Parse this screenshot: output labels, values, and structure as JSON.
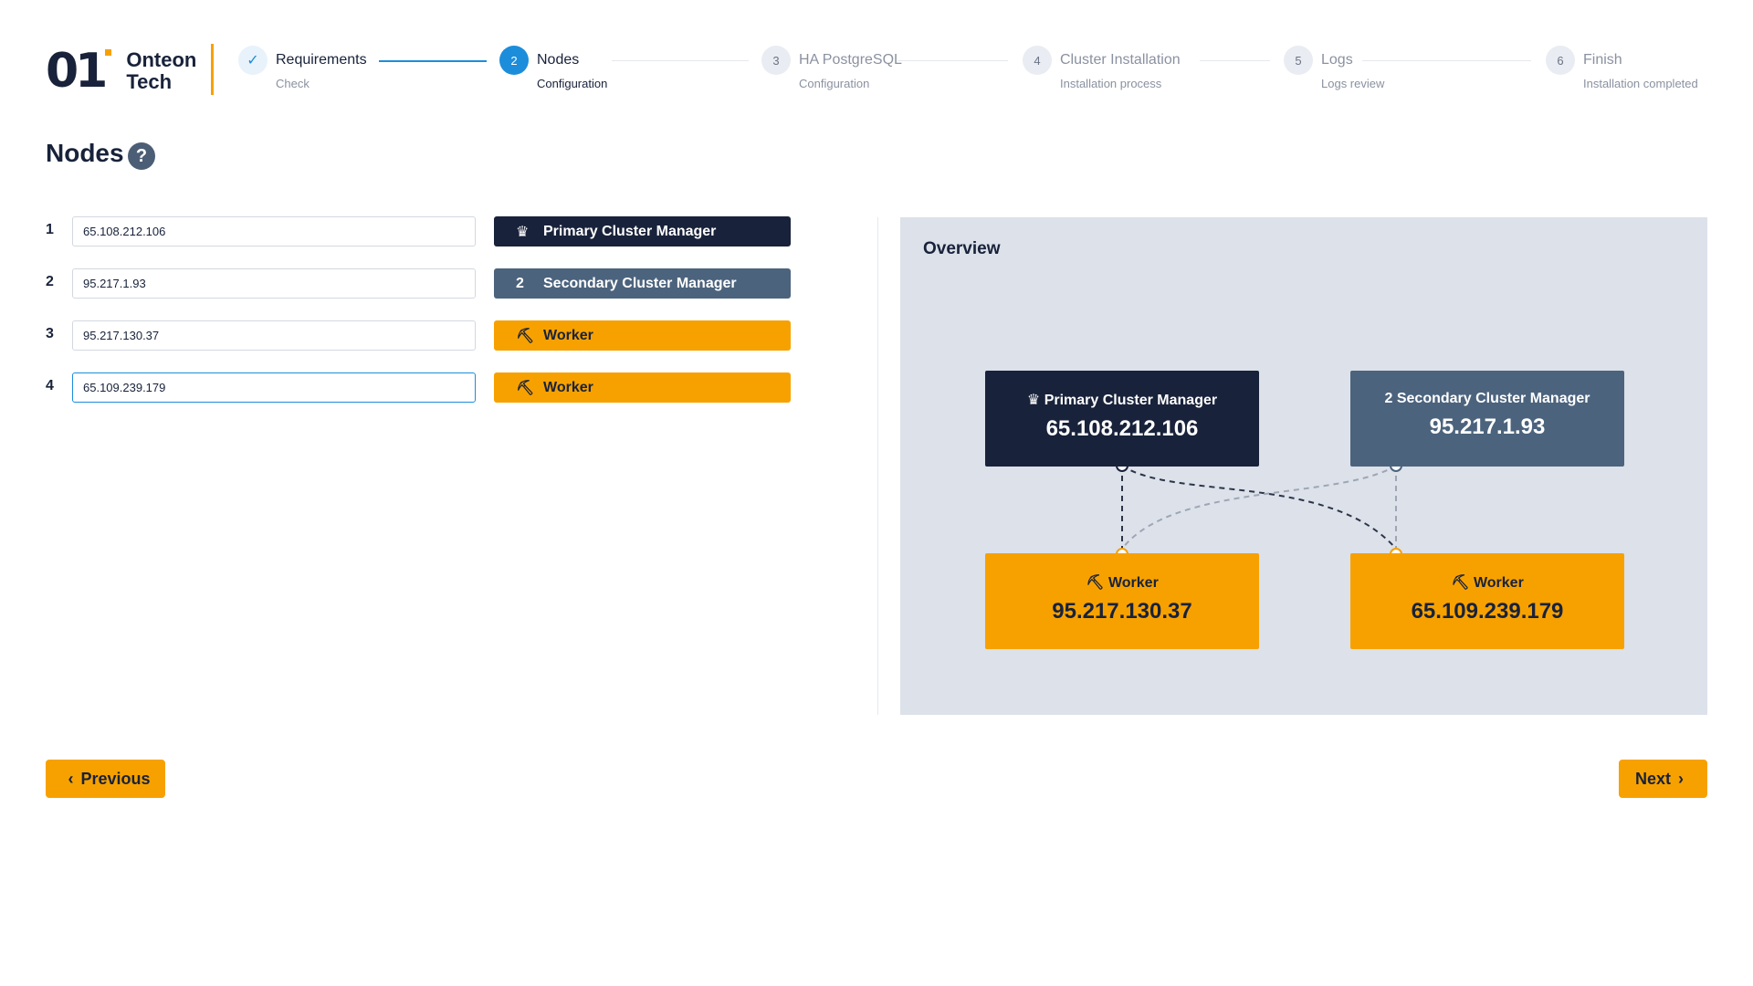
{
  "brand": {
    "mark": "01",
    "name_line1": "Onteon",
    "name_line2": "Tech"
  },
  "steps": [
    {
      "num": "✓",
      "title": "Requirements",
      "sub": "Check",
      "state": "done"
    },
    {
      "num": "2",
      "title": "Nodes",
      "sub": "Configuration",
      "state": "active"
    },
    {
      "num": "3",
      "title": "HA PostgreSQL",
      "sub": "Configuration",
      "state": "pending"
    },
    {
      "num": "4",
      "title": "Cluster Installation",
      "sub": "Installation process",
      "state": "pending"
    },
    {
      "num": "5",
      "title": "Logs",
      "sub": "Logs review",
      "state": "pending"
    },
    {
      "num": "6",
      "title": "Finish",
      "sub": "Installation completed",
      "state": "pending"
    }
  ],
  "page": {
    "title": "Nodes",
    "help": "?"
  },
  "nodes": [
    {
      "num": "1",
      "ip": "65.108.212.106",
      "role": "Primary Cluster Manager",
      "role_icon": "crown-icon"
    },
    {
      "num": "2",
      "ip": "95.217.1.93",
      "role": "Secondary Cluster Manager",
      "role_icon": "number-2-icon"
    },
    {
      "num": "3",
      "ip": "95.217.130.37",
      "role": "Worker",
      "role_icon": "worker-icon"
    },
    {
      "num": "4",
      "ip": "65.109.239.179",
      "role": "Worker",
      "role_icon": "worker-icon"
    }
  ],
  "overview": {
    "title": "Overview",
    "cards": [
      {
        "label": "Primary Cluster Manager",
        "ip": "65.108.212.106"
      },
      {
        "label": "Secondary Cluster Manager",
        "ip": "95.217.1.93"
      },
      {
        "label": "Worker",
        "ip": "95.217.130.37"
      },
      {
        "label": "Worker",
        "ip": "65.109.239.179"
      }
    ]
  },
  "nav": {
    "previous": "Previous",
    "next": "Next"
  },
  "colors": {
    "navy": "#18223a",
    "slate": "#4c637d",
    "orange": "#f7a100",
    "blue": "#1c8ddb",
    "overview_bg": "#dce1ea"
  }
}
